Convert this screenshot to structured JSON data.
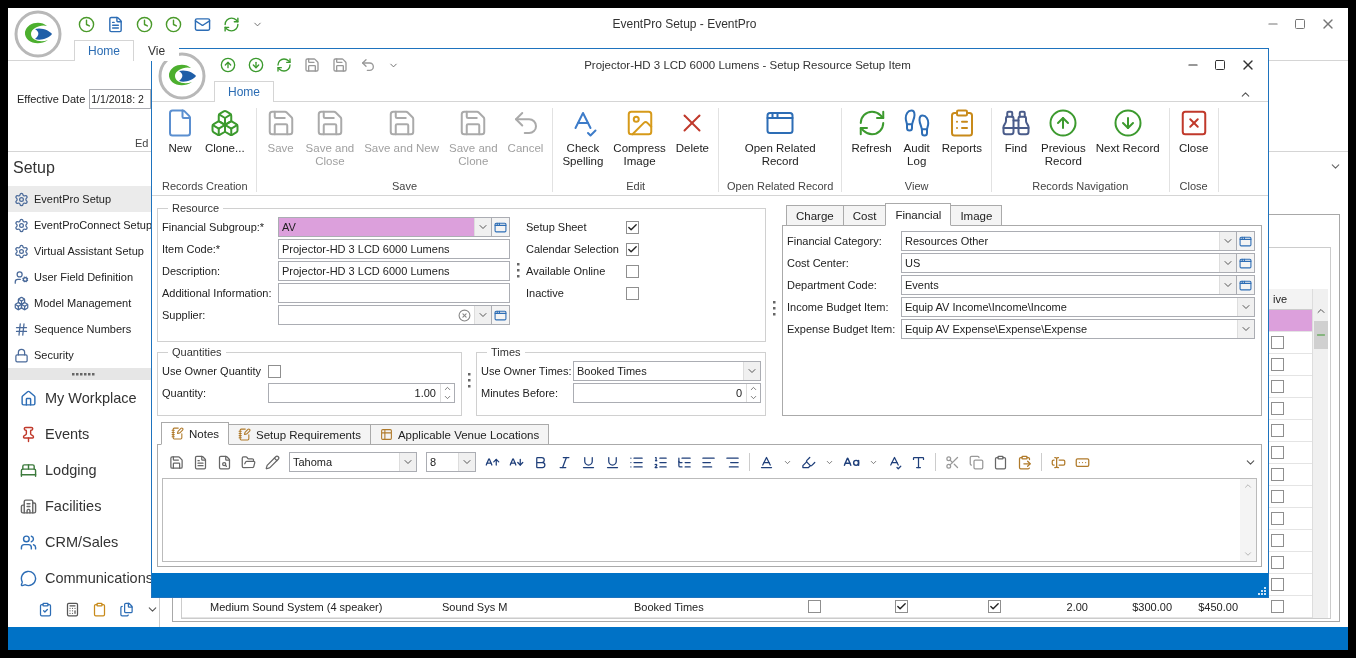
{
  "main_window": {
    "title": "EventPro Setup - EventPro",
    "tabs": [
      {
        "label": "Home",
        "selected": true
      },
      {
        "label": "Vie",
        "selected": false
      }
    ],
    "effective_date": {
      "label": "Effective Date",
      "value": "1/1/2018: 2"
    },
    "ribbon_group_label": "Ed",
    "sidebar": {
      "title": "Setup",
      "items": [
        {
          "label": "EventPro Setup",
          "selected": true
        },
        {
          "label": "EventProConnect Setup",
          "selected": false
        },
        {
          "label": "Virtual Assistant Setup",
          "selected": false
        },
        {
          "label": "User Field Definition",
          "selected": false
        },
        {
          "label": "Model Management",
          "selected": false
        },
        {
          "label": "Sequence Numbers",
          "selected": false
        },
        {
          "label": "Security",
          "selected": false
        }
      ]
    },
    "navigation": [
      "My Workplace",
      "Events",
      "Lodging",
      "Facilities",
      "CRM/Sales",
      "Communications"
    ],
    "grid": {
      "header": "ive",
      "rows": [
        {
          "selected": true
        },
        {
          "selected": false,
          "checked": false
        },
        {
          "selected": false,
          "checked": false
        },
        {
          "selected": false,
          "checked": false
        },
        {
          "selected": false,
          "checked": false
        },
        {
          "selected": false,
          "checked": false
        },
        {
          "selected": false,
          "checked": false
        },
        {
          "selected": false,
          "checked": false
        },
        {
          "selected": false,
          "checked": false
        },
        {
          "selected": false,
          "checked": false
        },
        {
          "selected": false,
          "checked": false
        },
        {
          "selected": false,
          "checked": false
        },
        {
          "selected": false,
          "checked": false
        }
      ],
      "last_row": [
        {
          "kind": "text",
          "text": "Medium Sound System (4 speaker)"
        },
        {
          "kind": "text",
          "text": "Sound Sys M"
        },
        {
          "kind": "text",
          "text": "Booked Times"
        },
        {
          "kind": "check",
          "checked": false
        },
        {
          "kind": "check",
          "checked": true
        },
        {
          "kind": "check",
          "checked": true
        },
        {
          "kind": "number",
          "text": "2.00"
        },
        {
          "kind": "number",
          "text": "$300.00"
        },
        {
          "kind": "number",
          "text": "$450.00"
        },
        {
          "kind": "check",
          "checked": false
        }
      ]
    }
  },
  "dialog": {
    "title": "Projector-HD 3 LCD 6000 Lumens - Setup Resource Setup Item",
    "tabs": [
      {
        "label": "Home",
        "selected": true
      }
    ],
    "ribbon": [
      {
        "label": "Records Creation",
        "buttons": [
          {
            "label": "New",
            "disabled": false
          },
          {
            "label": "Clone...",
            "disabled": false
          }
        ]
      },
      {
        "label": "Save",
        "buttons": [
          {
            "label": "Save",
            "disabled": true
          },
          {
            "label": "Save and\nClose",
            "disabled": true
          },
          {
            "label": "Save and New",
            "disabled": true
          },
          {
            "label": "Save and\nClone",
            "disabled": true
          },
          {
            "label": "Cancel",
            "disabled": true
          }
        ]
      },
      {
        "label": "Edit",
        "buttons": [
          {
            "label": "Check\nSpelling",
            "disabled": false
          },
          {
            "label": "Compress\nImage",
            "disabled": false
          },
          {
            "label": "Delete",
            "disabled": false
          }
        ]
      },
      {
        "label": "Open Related Record",
        "buttons": [
          {
            "label": "Open Related\nRecord",
            "disabled": false
          }
        ]
      },
      {
        "label": "View",
        "buttons": [
          {
            "label": "Refresh",
            "disabled": false
          },
          {
            "label": "Audit\nLog",
            "disabled": false
          },
          {
            "label": "Reports",
            "disabled": false
          }
        ]
      },
      {
        "label": "Records Navigation",
        "buttons": [
          {
            "label": "Find",
            "disabled": false
          },
          {
            "label": "Previous\nRecord",
            "disabled": false
          },
          {
            "label": "Next Record",
            "disabled": false
          }
        ]
      },
      {
        "label": "Close",
        "buttons": [
          {
            "label": "Close",
            "disabled": false
          }
        ]
      }
    ],
    "resource": {
      "title": "Resource",
      "fields": [
        {
          "label": "Financial Subgroup:*",
          "kind": "combo_lookup",
          "value": "AV",
          "highlighted": true
        },
        {
          "label": "Item Code:*",
          "kind": "text",
          "value": "Projector-HD 3 LCD 6000 Lumens",
          "highlighted": false
        },
        {
          "label": "Description:",
          "kind": "text",
          "value": "Projector-HD 3 LCD 6000 Lumens",
          "highlighted": false
        },
        {
          "label": "Additional Information:",
          "kind": "text",
          "highlighted": false
        },
        {
          "label": "Supplier:",
          "kind": "clearable_combo_lookup",
          "highlighted": false
        }
      ],
      "options": [
        {
          "label": "Setup Sheet",
          "checked": true
        },
        {
          "label": "Calendar Selection",
          "checked": true
        },
        {
          "label": "Available Online",
          "checked": false
        },
        {
          "label": "Inactive",
          "checked": false
        }
      ]
    },
    "quantities": {
      "title": "Quantities",
      "fields": [
        {
          "label": "Use Owner Quantity",
          "kind": "checkbox",
          "checked": false
        },
        {
          "label": "Quantity:",
          "kind": "spin",
          "value": "1.00"
        }
      ]
    },
    "times": {
      "title": "Times",
      "fields": [
        {
          "label": "Use Owner Times:",
          "kind": "combo",
          "value": "Booked Times"
        },
        {
          "label": "Minutes Before:",
          "kind": "spin",
          "value": "0"
        }
      ]
    },
    "detail_tabs": [
      {
        "label": "Charge",
        "selected": false
      },
      {
        "label": "Cost",
        "selected": false
      },
      {
        "label": "Financial",
        "selected": true
      },
      {
        "label": "Image",
        "selected": false
      }
    ],
    "financial": {
      "fields": [
        {
          "label": "Financial Category:",
          "kind": "combo_lookup",
          "value": "Resources Other"
        },
        {
          "label": "Cost Center:",
          "kind": "combo_lookup",
          "value": "US"
        },
        {
          "label": "Department Code:",
          "kind": "combo_lookup",
          "value": "Events"
        },
        {
          "label": "Income Budget Item:",
          "kind": "combo",
          "value": "Equip AV Income\\Income\\Income"
        },
        {
          "label": "Expense Budget Item:",
          "kind": "combo",
          "value": "Equip AV Expense\\Expense\\Expense"
        }
      ]
    },
    "notes_tabs": [
      {
        "label": "Notes",
        "selected": true
      },
      {
        "label": "Setup Requirements",
        "selected": false
      },
      {
        "label": "Applicable Venue Locations",
        "selected": false
      }
    ],
    "editor": {
      "font": "Tahoma",
      "font_size": "8"
    }
  }
}
